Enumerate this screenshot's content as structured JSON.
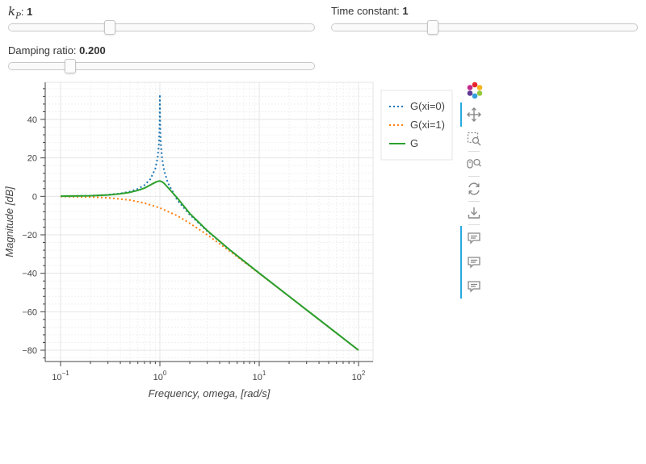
{
  "sliders": {
    "kp": {
      "label_main": "k",
      "label_sub": "P",
      "separator": ": ",
      "value_text": "1",
      "fraction": 0.33
    },
    "time_constant": {
      "label": "Time constant: ",
      "value_text": "1",
      "fraction": 0.33
    },
    "damping": {
      "label": "Damping ratio: ",
      "value_text": "0.200",
      "fraction": 0.2
    }
  },
  "toolbar": {
    "logo": "bokeh-logo-icon",
    "tools": [
      "pan-icon",
      "box-zoom-icon",
      "wheel-zoom-icon",
      "reset-icon",
      "save-icon",
      "hover-icon",
      "hover-icon",
      "hover-icon"
    ],
    "accent_color": "#26aae1"
  },
  "chart_data": {
    "type": "line",
    "title": "",
    "xlabel": "Frequency, omega, [rad/s]",
    "ylabel": "Magnitude [dB]",
    "x_scale": "log",
    "xlim": [
      0.1,
      100
    ],
    "ylim": [
      -85,
      60
    ],
    "x_ticks": [
      {
        "value": 0.1,
        "base": "10",
        "exp": "−1"
      },
      {
        "value": 1,
        "base": "10",
        "exp": "0"
      },
      {
        "value": 10,
        "base": "10",
        "exp": "1"
      },
      {
        "value": 100,
        "base": "10",
        "exp": "2"
      }
    ],
    "y_ticks": [
      40,
      20,
      0,
      -20,
      -40,
      -60,
      -80
    ],
    "y_tick_labels": [
      "40",
      "20",
      "0",
      "−20",
      "−40",
      "−60",
      "−80"
    ],
    "grid": true,
    "legend_position": "top-right-outside",
    "series": [
      {
        "name": "G(xi=0)",
        "color": "#1f77b4",
        "dash": "dotted",
        "x": [
          0.1,
          0.2,
          0.3,
          0.4,
          0.5,
          0.6,
          0.7,
          0.8,
          0.9,
          0.95,
          0.98,
          0.99,
          0.995,
          0.998,
          1.0,
          1.002,
          1.005,
          1.01,
          1.02,
          1.05,
          1.1,
          1.2,
          1.5,
          2,
          3,
          5,
          7,
          10,
          20,
          50,
          100
        ],
        "y": [
          0.09,
          0.35,
          0.82,
          1.51,
          2.5,
          3.88,
          5.85,
          8.87,
          14.4,
          20.2,
          28.0,
          34.0,
          40.0,
          48.0,
          53.0,
          48.0,
          40.0,
          34.0,
          28.0,
          20.2,
          13.6,
          7.2,
          -2.1,
          -9.5,
          -18.1,
          -27.6,
          -33.6,
          -39.9,
          -52.0,
          -67.9,
          -80.0
        ]
      },
      {
        "name": "G(xi=1)",
        "color": "#ff7f0e",
        "dash": "dotted",
        "x": [
          0.1,
          0.2,
          0.3,
          0.5,
          0.7,
          1,
          1.5,
          2,
          3,
          5,
          7,
          10,
          20,
          50,
          100
        ],
        "y": [
          -0.09,
          -0.34,
          -0.75,
          -1.94,
          -3.47,
          -6.02,
          -10.1,
          -14.0,
          -20.0,
          -28.3,
          -34.0,
          -40.1,
          -52.0,
          -68.0,
          -80.0
        ]
      },
      {
        "name": "G",
        "color": "#2ca02c",
        "dash": "solid",
        "x": [
          0.1,
          0.2,
          0.3,
          0.4,
          0.5,
          0.6,
          0.7,
          0.8,
          0.9,
          0.95,
          1.0,
          1.05,
          1.1,
          1.2,
          1.5,
          2,
          3,
          5,
          7,
          10,
          20,
          50,
          100
        ],
        "y": [
          0.08,
          0.32,
          0.74,
          1.34,
          2.1,
          3.1,
          4.3,
          5.9,
          7.3,
          7.8,
          8.0,
          7.6,
          6.8,
          4.7,
          -0.9,
          -8.9,
          -17.8,
          -27.6,
          -33.6,
          -39.9,
          -52.0,
          -67.9,
          -80.0
        ]
      }
    ]
  }
}
